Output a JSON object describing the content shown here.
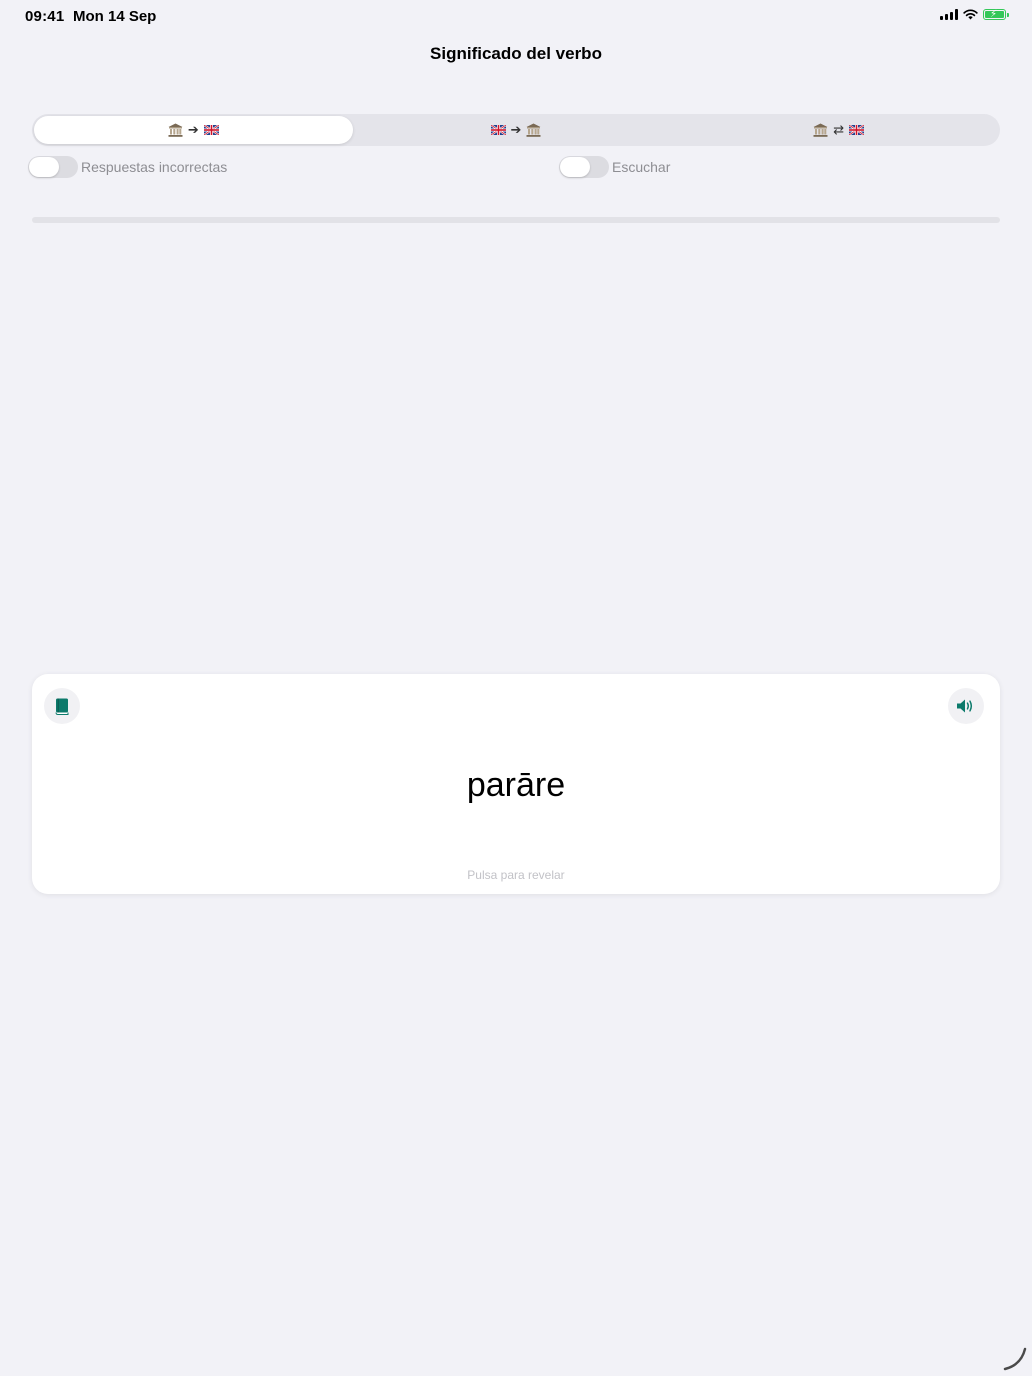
{
  "status_bar": {
    "time": "09:41",
    "date": "Mon 14 Sep"
  },
  "header": {
    "title": "Significado del verbo"
  },
  "segmented_control": {
    "selected_index": 0,
    "segments": [
      {
        "from_icon": "temple-icon",
        "arrow": "➔",
        "to_icon": "uk-flag-icon"
      },
      {
        "from_icon": "uk-flag-icon",
        "arrow": "➔",
        "to_icon": "temple-icon"
      },
      {
        "from_icon": "temple-icon",
        "arrow": "⇄",
        "to_icon": "uk-flag-icon"
      }
    ]
  },
  "toggles": {
    "incorrect_answers": {
      "label": "Respuestas incorrectas",
      "on": false
    },
    "listen": {
      "label": "Escuchar",
      "on": false
    }
  },
  "progress": {
    "fraction": 0
  },
  "flashcard": {
    "word": "parāre",
    "hint": "Pulsa para revelar",
    "left_icon": "book-icon",
    "right_icon": "speaker-icon"
  },
  "colors": {
    "background": "#f2f2f7",
    "accent": "#0c7a6b",
    "battery": "#34c759"
  }
}
